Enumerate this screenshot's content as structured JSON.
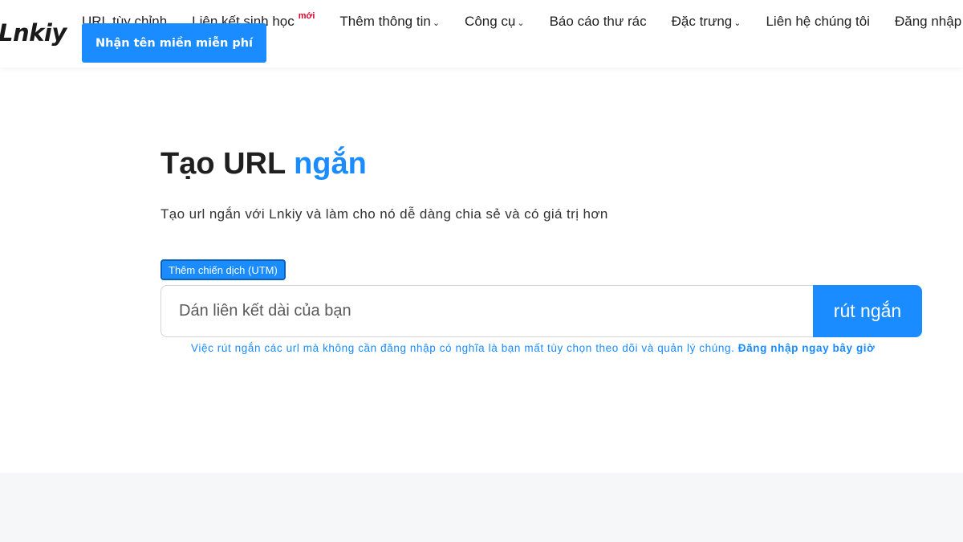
{
  "brand": {
    "logo_text": "Lnkiy",
    "accent_color": "#1a8cff"
  },
  "nav": {
    "items": [
      {
        "label": "URL tùy chỉnh"
      },
      {
        "label": "Liên kết sinh học",
        "badge": "mới"
      },
      {
        "label": "Thêm thông tin",
        "dropdown": true
      },
      {
        "label": "Công cụ",
        "dropdown": true
      },
      {
        "label": "Báo cáo thư rác"
      },
      {
        "label": "Đặc trưng",
        "dropdown": true
      },
      {
        "label": "Liên hệ chúng tôi"
      },
      {
        "label": "Đăng nhập"
      }
    ],
    "chevron_icon": "chevron-down-icon",
    "cta_label": "Nhận tên miền miễn phí"
  },
  "hero": {
    "title_main": "Tạo URL",
    "title_accent": "ngắn",
    "subtitle": "Tạo url ngắn với Lnkiy và làm cho nó dễ dàng chia sẻ và có giá trị hơn",
    "utm_label": "Thêm chiến dịch (UTM)",
    "input_value": "",
    "input_placeholder": "Dán liên kết dài của bạn",
    "shorten_label": "rút ngắn",
    "note_text": "Việc rút ngắn các url mà không cần đăng nhập có nghĩa là bạn mất tùy chọn theo dõi và quản lý chúng.",
    "note_link": "Đăng nhập ngay bây giờ"
  }
}
